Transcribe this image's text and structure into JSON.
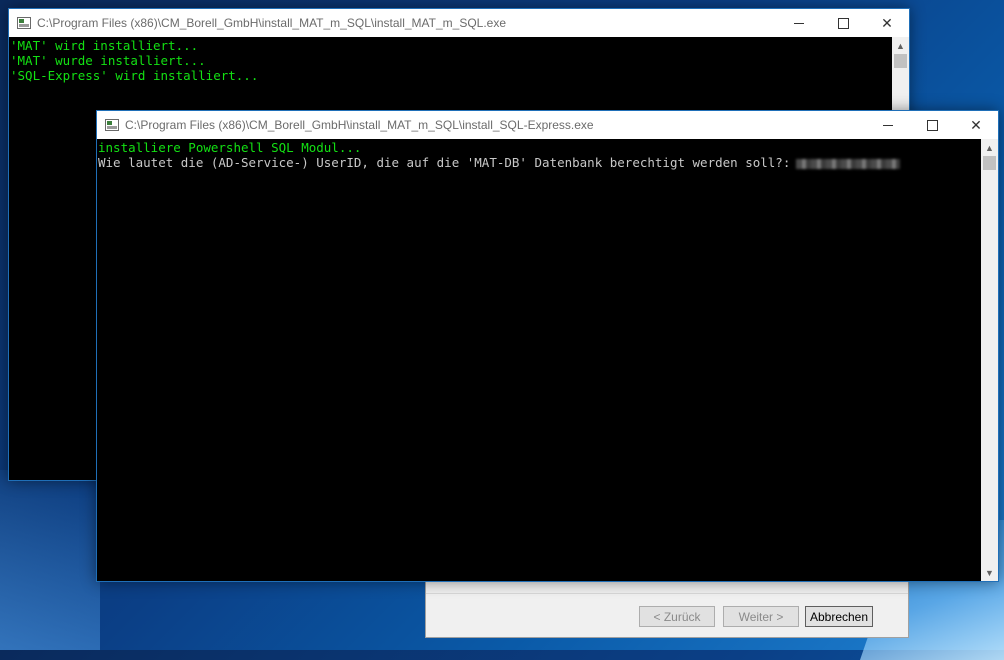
{
  "colors": {
    "console_green": "#13e013",
    "console_grey": "#c8c8c8",
    "console_bg": "#000000"
  },
  "window_back": {
    "title": "C:\\Program Files (x86)\\CM_Borell_GmbH\\install_MAT_m_SQL\\install_MAT_m_SQL.exe",
    "lines": [
      "'MAT' wird installiert...",
      "'MAT' wurde installiert...",
      "'SQL-Express' wird installiert..."
    ]
  },
  "window_front": {
    "title": "C:\\Program Files (x86)\\CM_Borell_GmbH\\install_MAT_m_SQL\\install_SQL-Express.exe",
    "line1": "installiere Powershell SQL Modul...",
    "line2": "Wie lautet die (AD-Service-) UserID, die auf die 'MAT-DB' Datenbank berechtigt werden soll?:"
  },
  "controls": {
    "minimize": "—",
    "maximize": "☐",
    "close": "✕"
  },
  "scroll_arrows": {
    "up": "▲",
    "down": "▼"
  },
  "wizard": {
    "back_label": "< Zurück",
    "next_label": "Weiter >",
    "cancel_label": "Abbrechen"
  }
}
